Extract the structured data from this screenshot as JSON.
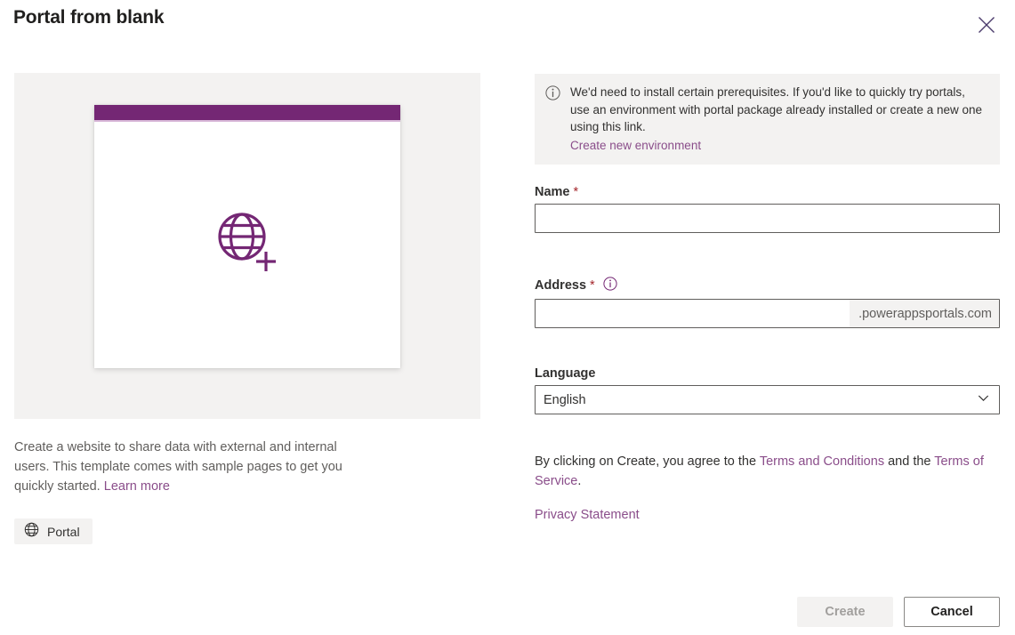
{
  "header": {
    "title": "Portal from blank",
    "close_icon": "close-icon"
  },
  "preview": {
    "card_icon": "globe-add-icon",
    "accent_color": "#742774",
    "panel_background": "#f3f2f1"
  },
  "left": {
    "description_part1": "Create a website to share data with external and internal users. This template comes with sample pages to get you quickly started. ",
    "learn_more_label": "Learn more",
    "tag_icon": "globe-icon",
    "tag_label": "Portal"
  },
  "banner": {
    "icon": "info-icon",
    "text": "We'd need to install certain prerequisites. If you'd like to quickly try portals, use an environment with portal package already installed or create a new one using this link.",
    "link_label": "Create new environment"
  },
  "form": {
    "name": {
      "label": "Name",
      "required_marker": "*",
      "value": "",
      "placeholder": ""
    },
    "address": {
      "label": "Address",
      "required_marker": "*",
      "info_icon": "info-icon",
      "value": "",
      "placeholder": "",
      "suffix": ".powerappsportals.com"
    },
    "language": {
      "label": "Language",
      "value": "English",
      "chevron_icon": "chevron-down-icon"
    }
  },
  "terms": {
    "intro": "By clicking on Create, you agree to the ",
    "terms_conditions_label": "Terms and Conditions",
    "middle": " and the ",
    "terms_of_service_label": "Terms of Service",
    "period": ".",
    "privacy_label": "Privacy Statement"
  },
  "footer": {
    "create_label": "Create",
    "cancel_label": "Cancel"
  },
  "colors": {
    "accent_purple": "#742774",
    "link_purple": "#8a4d8a",
    "required_red": "#a4262c",
    "neutral_light": "#f3f2f1"
  }
}
